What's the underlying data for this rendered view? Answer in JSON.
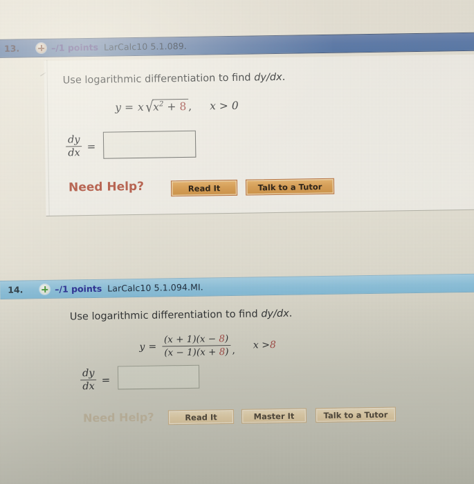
{
  "screen": {
    "background_color": "#e7e2d6",
    "header_dark_color": "#5d7aa9",
    "header_light_color": "#8dc2dd"
  },
  "problems": [
    {
      "number": "13.",
      "expand_icon": "plus-circle-icon",
      "points": "–/1 points",
      "code": "LarCalc10 5.1.089.",
      "prompt_text": "Use logarithmic differentiation to find ",
      "prompt_math": "dy/dx",
      "prompt_end": ".",
      "equation": {
        "lhs": "y",
        "equals": "=",
        "coefficient": "x",
        "radicand_base": "x",
        "radicand_exponent": "2",
        "radicand_plus": "+",
        "radicand_constant": "8",
        "comma": ",",
        "domain": "x > 0"
      },
      "answer_label_num": "dy",
      "answer_label_den": "dx",
      "answer_equals": "=",
      "answer_value": "",
      "answer_placeholder": "",
      "need_help_label": "Need Help?",
      "buttons": [
        "Read It",
        "Talk to a Tutor"
      ]
    },
    {
      "number": "14.",
      "expand_icon": "plus-circle-icon",
      "points": "–/1 points",
      "code": "LarCalc10 5.1.094.MI.",
      "prompt_text": "Use logarithmic differentiation to find ",
      "prompt_math": "dy/dx",
      "prompt_end": ".",
      "equation": {
        "lhs": "y",
        "equals": "=",
        "numerator_a": "(x + 1)(x − ",
        "numerator_const": "8",
        "numerator_b": ")",
        "denominator_a": "(x − 1)(x + ",
        "denominator_const": "8",
        "denominator_b": ")",
        "comma": ",",
        "domain_prefix": "x > ",
        "domain_const": "8"
      },
      "answer_label_num": "dy",
      "answer_label_den": "dx",
      "answer_equals": "=",
      "answer_value": "",
      "answer_placeholder": "",
      "need_help_label": "Need Help?",
      "buttons": [
        "Read It",
        "Master It",
        "Talk to a Tutor"
      ]
    }
  ]
}
